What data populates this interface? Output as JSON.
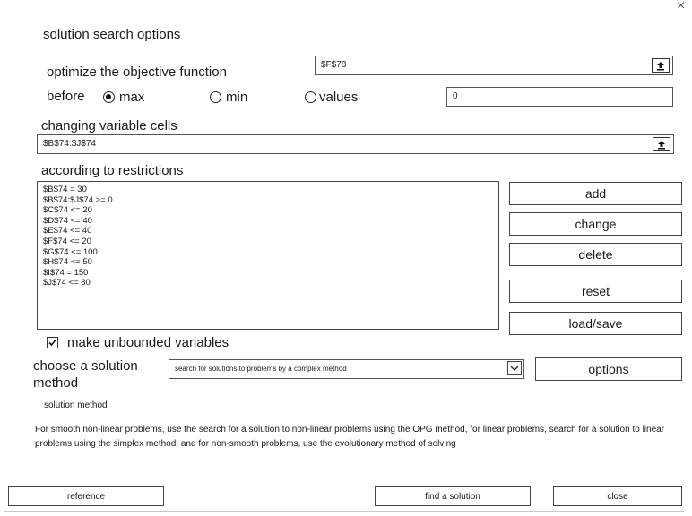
{
  "dialog": {
    "title": "solution search options",
    "close_icon": "×"
  },
  "objective": {
    "label": "optimize the objective function",
    "cell_value": "$F$78",
    "before_label": "before",
    "options": [
      {
        "label": "max",
        "selected": true
      },
      {
        "label": "min",
        "selected": false
      },
      {
        "label": "values",
        "selected": false
      }
    ],
    "values_field": "0"
  },
  "changing": {
    "label": "changing variable cells",
    "value": "$B$74:$J$74"
  },
  "restrictions": {
    "label": "according to restrictions",
    "items": [
      "$B$74 = 30",
      "$B$74:$J$74 >= 0",
      "$C$74 <= 20",
      "$D$74 <= 40",
      "$E$74 <= 40",
      "$F$74 <= 20",
      "$G$74 <= 100",
      "$H$74 <= 50",
      "$I$74 = 150",
      "$J$74 <= 80"
    ],
    "buttons": {
      "add": "add",
      "change": "change",
      "delete": "delete",
      "reset": "reset",
      "load_save": "load/save"
    }
  },
  "unbounded": {
    "label": "make unbounded variables",
    "checked": true
  },
  "method": {
    "label_line1": "choose a solution",
    "label_line2": "method",
    "selected": "search for solutions to problems by a complex method",
    "options_button": "options",
    "section_label": "solution method",
    "description": "For smooth non-linear problems, use the search for a solution to non-linear problems using the OPG method, for linear problems, search for a solution to linear problems using the simplex method, and for non-smooth problems, use the evolutionary method of solving"
  },
  "footer": {
    "reference": "reference",
    "find": "find a solution",
    "close": "close"
  },
  "icons": {
    "upload": "upload-arrow-icon",
    "dropdown": "chevron-down-icon",
    "check": "checkmark-icon"
  }
}
